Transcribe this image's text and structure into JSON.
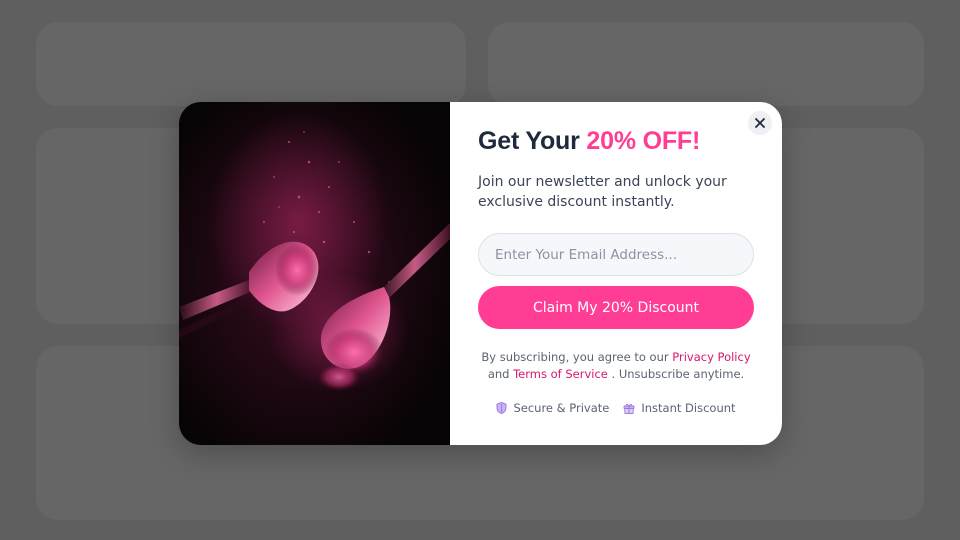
{
  "popup": {
    "title_prefix": "Get Your",
    "title_accent": "20% OFF!",
    "subtitle": "Join our newsletter and unlock your exclusive discount instantly.",
    "email_placeholder": "Enter Your Email Address...",
    "cta_label": "Claim My 20% Discount",
    "close_label": "×",
    "legal": {
      "prefix": "By subscribing, you agree to our",
      "privacy_link": "Privacy Policy",
      "and": "and",
      "terms_link": "Terms of Service",
      "suffix": ". Unsubscribe anytime."
    },
    "badges": [
      {
        "label": "Secure & Private",
        "icon": "shield-icon"
      },
      {
        "label": "Instant Discount",
        "icon": "gift-icon"
      }
    ],
    "image": {
      "subject": "makeup-brushes-pink-powder"
    }
  },
  "colors": {
    "accent": "#ff3d94",
    "link": "#d6186f",
    "title": "#1e2a3b",
    "overlay": "#5f5f5f"
  }
}
